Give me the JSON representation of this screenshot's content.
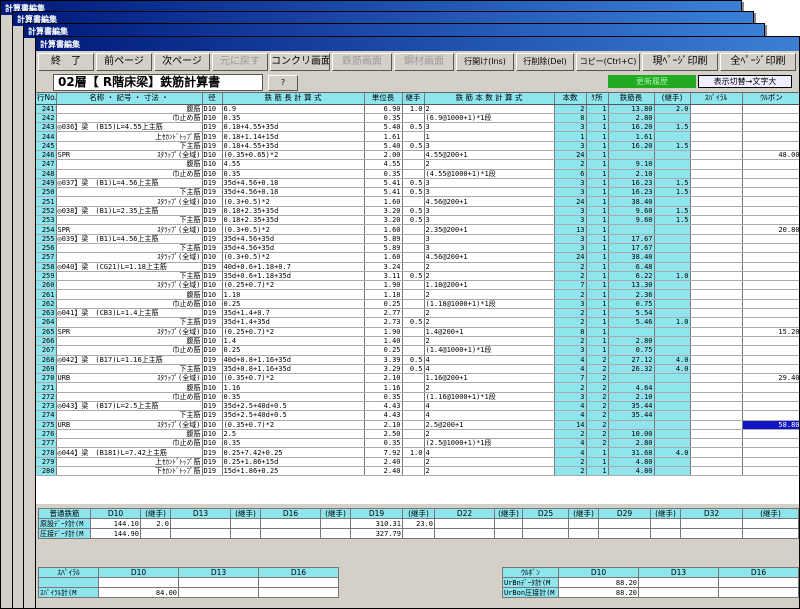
{
  "window_title": "計算書編集",
  "toolbar": {
    "buttons": [
      "終　了",
      "前ページ",
      "次ページ",
      "元に戻す",
      "コンクリ画面",
      "鉄筋画面",
      "鋼材画面",
      "行開け(Ins)",
      "行削除(Del)",
      "コピー(Ctrl+C)",
      "現ﾍﾟｰｼﾞ印刷",
      "全ﾍﾟｰｼﾞ印刷"
    ]
  },
  "sheet": {
    "title": "02層【 R階床梁】鉄筋計算書",
    "help_button": "?",
    "history_button": "更新履歴",
    "display_toggle": "表示切替→文字大"
  },
  "grid": {
    "headers": [
      "行No.",
      "名称 ・ 記号 ・ 寸法 ・",
      "径",
      "鉄 筋 長 計 算 式",
      "単位長",
      "継手",
      "鉄 筋 本 数 計 算 式",
      "本数",
      "ｹ所",
      "鉄筋長",
      "(継手)",
      "ｽﾊﾟｲﾗﾙ",
      "ｳﾙボン"
    ],
    "rows": [
      [
        "241",
        "腹筋",
        "D10",
        "6.9",
        "6.90",
        "1.0",
        "2",
        "2",
        "1",
        "13.80",
        "2.0",
        "",
        ""
      ],
      [
        "242",
        "巾止め筋",
        "D10",
        "0.35",
        "0.35",
        "",
        "(6.9@1000+1)*1段",
        "8",
        "1",
        "2.80",
        "",
        "",
        ""
      ],
      [
        "243",
        "◎036】梁　(B15)L=4.55上主筋",
        "D19",
        "0.18+4.55+35d",
        "5.40",
        "0.5",
        "3",
        "3",
        "1",
        "16.20",
        "1.5",
        "",
        ""
      ],
      [
        "244",
        "上ｾｶﾝﾄﾞﾄｯﾌﾟ筋",
        "D19",
        "0.18+1.14+15d",
        "1.61",
        "",
        "1",
        "1",
        "1",
        "1.61",
        "",
        "",
        ""
      ],
      [
        "245",
        "下主筋",
        "D19",
        "0.18+4.55+35d",
        "5.40",
        "0.5",
        "3",
        "3",
        "1",
        "16.20",
        "1.5",
        "",
        ""
      ],
      [
        "246",
        "SPR",
        "ｽﾀﾗｯﾌﾟ(全域)",
        "D10",
        "(0.35+0.65)*2",
        "2.00",
        "",
        "4.55@200+1",
        "24",
        "1",
        "",
        "",
        "48.00"
      ],
      [
        "247",
        "腹筋",
        "D10",
        "4.55",
        "4.55",
        "",
        "2",
        "2",
        "1",
        "9.10",
        "",
        ""
      ],
      [
        "248",
        "巾止め筋",
        "D10",
        "0.35",
        "0.35",
        "",
        "(4.55@1000+1)*1段",
        "6",
        "1",
        "2.10",
        "",
        ""
      ],
      [
        "249",
        "◎037】梁　(B1)L=4.56上主筋",
        "D19",
        "35d+4.56+0.18",
        "5.41",
        "0.5",
        "3",
        "3",
        "1",
        "16.23",
        "1.5",
        "",
        ""
      ],
      [
        "250",
        "下主筋",
        "D19",
        "35d+4.56+0.18",
        "5.41",
        "0.5",
        "3",
        "3",
        "1",
        "16.23",
        "1.5",
        "",
        ""
      ],
      [
        "251",
        "ｽﾀﾗｯﾌﾟ(全域)",
        "D10",
        "(0.3+0.5)*2",
        "1.60",
        "",
        "4.56@200+1",
        "24",
        "1",
        "38.40",
        "",
        "",
        ""
      ],
      [
        "252",
        "◎038】梁　(B1)L=2.35上主筋",
        "D19",
        "0.18+2.35+35d",
        "3.20",
        "0.5",
        "3",
        "3",
        "1",
        "9.60",
        "1.5",
        "",
        ""
      ],
      [
        "253",
        "下主筋",
        "D19",
        "0.18+2.35+35d",
        "3.20",
        "0.5",
        "3",
        "3",
        "1",
        "9.60",
        "1.5",
        "",
        ""
      ],
      [
        "254",
        "SPR",
        "ｽﾀﾗｯﾌﾟ(全域)",
        "D10",
        "(0.3+0.5)*2",
        "1.60",
        "",
        "2.35@200+1",
        "13",
        "1",
        "",
        "",
        "20.80"
      ],
      [
        "255",
        "◎039】梁　(B1)L=4.56上主筋",
        "D19",
        "35d+4.56+35d",
        "5.89",
        "",
        "3",
        "3",
        "1",
        "17.67",
        "",
        "",
        ""
      ],
      [
        "256",
        "下主筋",
        "D19",
        "35d+4.56+35d",
        "5.89",
        "",
        "3",
        "3",
        "1",
        "17.67",
        "",
        "",
        ""
      ],
      [
        "257",
        "ｽﾀﾗｯﾌﾟ(全域)",
        "D10",
        "(0.3+0.5)*2",
        "1.60",
        "",
        "4.56@200+1",
        "24",
        "1",
        "38.40",
        "",
        "",
        ""
      ],
      [
        "258",
        "◎040】梁　(CG21)L=1.18上主筋",
        "D19",
        "40d+0.6+1.18+0.7",
        "3.24",
        "",
        "2",
        "2",
        "1",
        "6.48",
        "",
        "",
        ""
      ],
      [
        "259",
        "下主筋",
        "D19",
        "35d+0.6+1.18+35d",
        "3.11",
        "0.5",
        "2",
        "2",
        "1",
        "6.22",
        "1.0",
        "",
        ""
      ],
      [
        "260",
        "ｽﾀﾗｯﾌﾟ(全域)",
        "D10",
        "(0.25+0.7)*2",
        "1.90",
        "",
        "1.18@200+1",
        "7",
        "1",
        "13.30",
        "",
        "",
        ""
      ],
      [
        "261",
        "腹筋",
        "D10",
        "1.18",
        "1.18",
        "",
        "2",
        "2",
        "1",
        "2.36",
        "",
        "",
        ""
      ],
      [
        "262",
        "巾止め筋",
        "D10",
        "0.25",
        "0.25",
        "",
        "(1.18@1000+1)*1段",
        "3",
        "1",
        "0.75",
        "",
        "",
        ""
      ],
      [
        "263",
        "◎041】梁　(CB3)L=1.4上主筋",
        "D19",
        "35d+1.4+0.7",
        "2.77",
        "",
        "2",
        "2",
        "1",
        "5.54",
        "",
        "",
        ""
      ],
      [
        "264",
        "下主筋",
        "D19",
        "35d+1.4+35d",
        "2.73",
        "0.5",
        "2",
        "2",
        "1",
        "5.46",
        "1.0",
        "",
        ""
      ],
      [
        "265",
        "SPR",
        "ｽﾀﾗｯﾌﾟ(全域)",
        "D10",
        "(0.25+0.7)*2",
        "1.90",
        "",
        "1.4@200+1",
        "8",
        "1",
        "",
        "",
        "15.20"
      ],
      [
        "266",
        "腹筋",
        "D10",
        "1.4",
        "1.40",
        "",
        "2",
        "2",
        "1",
        "2.80",
        "",
        "",
        ""
      ],
      [
        "267",
        "巾止め筋",
        "D10",
        "0.25",
        "0.25",
        "",
        "(1.4@1000+1)*1段",
        "3",
        "1",
        "0.75",
        "",
        "",
        ""
      ],
      [
        "268",
        "◎042】梁　(B17)L=1.16上主筋",
        "D19",
        "40d+0.8+1.16+35d",
        "3.39",
        "0.5",
        "4",
        "4",
        "2",
        "27.12",
        "4.0",
        "",
        ""
      ],
      [
        "269",
        "下主筋",
        "D19",
        "35d+0.8+1.16+35d",
        "3.29",
        "0.5",
        "4",
        "4",
        "2",
        "26.32",
        "4.0",
        "",
        ""
      ],
      [
        "270",
        "URB",
        "ｽﾀﾗｯﾌﾟ(全域)",
        "D10",
        "(0.35+0.7)*2",
        "2.10",
        "",
        "1.16@200+1",
        "7",
        "2",
        "",
        "",
        "",
        "29.40"
      ],
      [
        "271",
        "腹筋",
        "D10",
        "1.16",
        "1.16",
        "",
        "2",
        "2",
        "2",
        "4.64",
        "",
        "",
        ""
      ],
      [
        "272",
        "巾止め筋",
        "D10",
        "0.35",
        "0.35",
        "",
        "(1.16@1000+1)*1段",
        "3",
        "2",
        "2.10",
        "",
        "",
        ""
      ],
      [
        "273",
        "◎043】梁　(B17)L=2.5上主筋",
        "D19",
        "35d+2.5+40d+0.5",
        "4.43",
        "",
        "4",
        "4",
        "2",
        "35.44",
        "",
        "",
        ""
      ],
      [
        "274",
        "下主筋",
        "D19",
        "35d+2.5+40d+0.5",
        "4.43",
        "",
        "4",
        "4",
        "2",
        "35.44",
        "",
        "",
        ""
      ],
      [
        "275",
        "URB",
        "ｽﾀﾗｯﾌﾟ(全域)",
        "D10",
        "(0.35+0.7)*2",
        "2.10",
        "",
        "2.5@200+1",
        "14",
        "2",
        "",
        "",
        "",
        "58.80"
      ],
      [
        "276",
        "腹筋",
        "D10",
        "2.5",
        "2.50",
        "",
        "2",
        "2",
        "2",
        "10.00",
        "",
        "",
        ""
      ],
      [
        "277",
        "巾止め筋",
        "D10",
        "0.35",
        "0.35",
        "",
        "(2.5@1000+1)*1段",
        "4",
        "2",
        "2.80",
        "",
        "",
        ""
      ],
      [
        "278",
        "◎044】梁　(B181)L=7.42上主筋",
        "D19",
        "0.25+7.42+0.25",
        "7.92",
        "1.0",
        "4",
        "4",
        "1",
        "31.68",
        "4.0",
        "",
        ""
      ],
      [
        "279",
        "上ｾｶﾝﾄﾞﾄｯﾌﾟ筋",
        "D19",
        "0.25+1.86+15d",
        "2.40",
        "",
        "2",
        "2",
        "1",
        "4.80",
        "",
        "",
        ""
      ],
      [
        "280",
        "下ｾｶﾝﾄﾞﾄｯﾌﾟ筋",
        "D19",
        "15d+1.86+0.25",
        "2.40",
        "",
        "2",
        "2",
        "1",
        "4.80",
        "",
        "",
        ""
      ]
    ]
  },
  "summary": {
    "headers": [
      "普通鉄筋",
      "D10",
      "(継手)",
      "D13",
      "(継手)",
      "D16",
      "(継手)",
      "D19",
      "(継手)",
      "D22",
      "(継手)",
      "D25",
      "(継手)",
      "D29",
      "(継手)",
      "D32",
      "(継手)"
    ],
    "rows": [
      [
        "原設ﾃﾞｰﾀ計(M",
        "144.10",
        "2.0",
        "",
        "",
        "",
        "",
        "310.31",
        "23.0",
        "",
        "",
        "",
        "",
        "",
        "",
        "",
        ""
      ],
      [
        "圧接ﾃﾞｰﾀ計(M",
        "144.90",
        "",
        "",
        "",
        "",
        "",
        "327.79",
        "",
        "",
        "",
        "",
        "",
        "",
        "",
        "",
        ""
      ]
    ]
  },
  "spiral": {
    "headers": [
      "ｽﾊﾟｲﾗﾙ",
      "D10",
      "D13",
      "D16"
    ],
    "label": "ｽﾊﾟｲﾗﾙ計(M",
    "values": [
      "84.00",
      "",
      ""
    ]
  },
  "urubon": {
    "headers": [
      "ｳﾙﾎﾞﾝ",
      "D10",
      "D13",
      "D16"
    ],
    "rows": [
      [
        "UrBnﾃﾞｰﾀ計(M",
        "88.20",
        "",
        ""
      ],
      [
        "UrBon圧接計(M",
        "88.20",
        "",
        ""
      ]
    ]
  }
}
